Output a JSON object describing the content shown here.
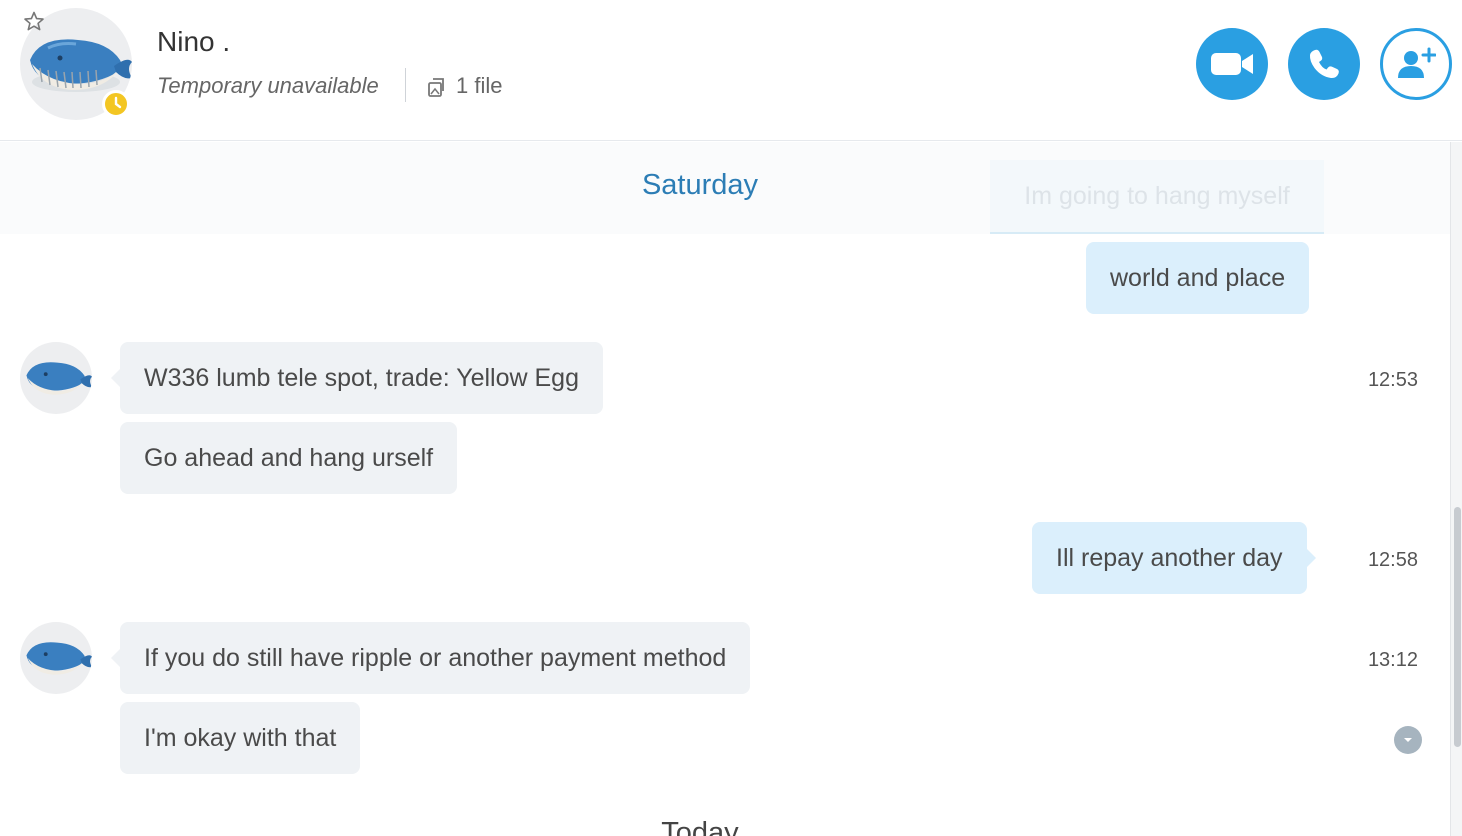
{
  "header": {
    "name": "Nino .",
    "status": "Temporary unavailable",
    "file_count": "1 file",
    "icons": {
      "favorite": "star-icon",
      "status": "clock-icon",
      "files": "file-icon",
      "video": "video-camera-icon",
      "call": "phone-icon",
      "add": "add-person-icon"
    },
    "colors": {
      "accent": "#2a9fe2",
      "away": "#f3c623"
    }
  },
  "chat": {
    "day_labels": [
      "Saturday",
      "Today"
    ],
    "messages": [
      {
        "dir": "out",
        "text": "Im going to hang myself",
        "time": ""
      },
      {
        "dir": "out",
        "text": "world and place",
        "time": ""
      },
      {
        "dir": "in",
        "text": "W336 lumb tele spot, trade: Yellow Egg",
        "time": "12:53"
      },
      {
        "dir": "in",
        "text": "Go ahead and hang urself",
        "time": ""
      },
      {
        "dir": "out",
        "text": "Ill repay another day",
        "time": "12:58"
      },
      {
        "dir": "in",
        "text": "If you do still have ripple or another payment method",
        "time": "13:12"
      },
      {
        "dir": "in",
        "text": "I'm okay with that",
        "time": ""
      }
    ],
    "colors": {
      "incoming_bubble": "#eff2f5",
      "outgoing_bubble": "#dbeffc",
      "day_label": "#2c7db5"
    }
  }
}
